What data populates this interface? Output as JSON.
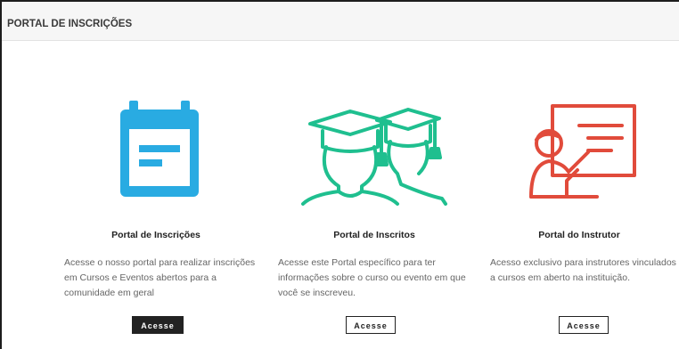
{
  "header": {
    "title": "PORTAL DE INSCRIÇÕES"
  },
  "colors": {
    "inscricoes_icon": "#29abe2",
    "inscritos_icon": "#1fbf8f",
    "instrutor_icon": "#e14b3b"
  },
  "cards": [
    {
      "icon": "calendar-icon",
      "title": "Portal de Inscrições",
      "desc_lines": [
        "Acesse o nosso portal para realizar inscrições",
        "em Cursos e Eventos abertos para a",
        "comunidade em geral"
      ],
      "button_label": "Acesse"
    },
    {
      "icon": "graduates-icon",
      "title": "Portal de Inscritos",
      "desc_lines": [
        "Acesse este Portal específico para ter",
        "informações sobre o curso ou evento em que",
        "você se inscreveu."
      ],
      "button_label": "Acesse"
    },
    {
      "icon": "instructor-icon",
      "title": "Portal do Instrutor",
      "desc_lines": [
        "Acesso exclusivo para instrutores vinculados",
        "a cursos em aberto na instituição."
      ],
      "button_label": "Acesse"
    }
  ]
}
